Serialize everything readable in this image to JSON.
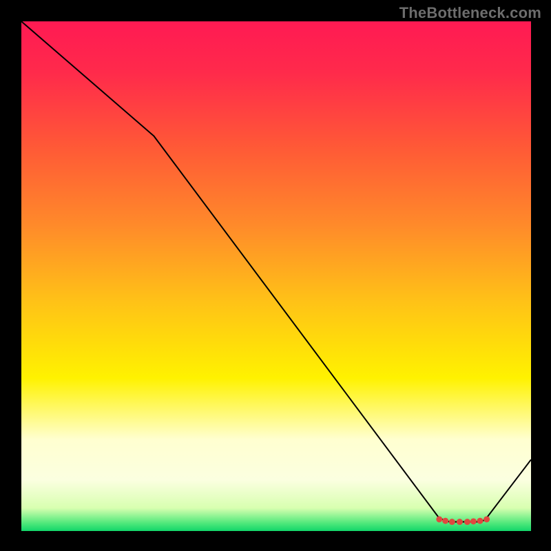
{
  "watermark": "TheBottleneck.com",
  "chart_data": {
    "type": "line",
    "title": "",
    "xlabel": "",
    "ylabel": "",
    "xlim": [
      0,
      100
    ],
    "ylim": [
      0,
      100
    ],
    "grid": false,
    "axis_visible": false,
    "background_gradient": {
      "stops": [
        {
          "offset": 0.0,
          "color": "#ff1a53"
        },
        {
          "offset": 0.1,
          "color": "#ff2a4b"
        },
        {
          "offset": 0.25,
          "color": "#ff5a36"
        },
        {
          "offset": 0.4,
          "color": "#ff8a2a"
        },
        {
          "offset": 0.55,
          "color": "#ffc217"
        },
        {
          "offset": 0.7,
          "color": "#fff200"
        },
        {
          "offset": 0.82,
          "color": "#ffffd0"
        },
        {
          "offset": 0.9,
          "color": "#fbffe0"
        },
        {
          "offset": 0.955,
          "color": "#d8ffb0"
        },
        {
          "offset": 0.985,
          "color": "#4ee87a"
        },
        {
          "offset": 1.0,
          "color": "#12d66a"
        }
      ]
    },
    "series": [
      {
        "name": "bottleneck-curve",
        "x": [
          0,
          26,
          82,
          84,
          90,
          91,
          100
        ],
        "y": [
          100,
          77.5,
          2.5,
          1.8,
          1.8,
          2.2,
          14
        ],
        "stroke": "#000000",
        "stroke_width": 2
      }
    ],
    "markers": {
      "name": "optimal-band",
      "shape": "circle",
      "radius": 4.5,
      "fill": "#e0483f",
      "points": [
        {
          "x": 82.0,
          "y": 2.3
        },
        {
          "x": 83.2,
          "y": 2.0
        },
        {
          "x": 84.5,
          "y": 1.8
        },
        {
          "x": 86.0,
          "y": 1.8
        },
        {
          "x": 87.5,
          "y": 1.8
        },
        {
          "x": 88.7,
          "y": 1.9
        },
        {
          "x": 90.0,
          "y": 2.0
        },
        {
          "x": 91.3,
          "y": 2.3
        }
      ]
    }
  }
}
